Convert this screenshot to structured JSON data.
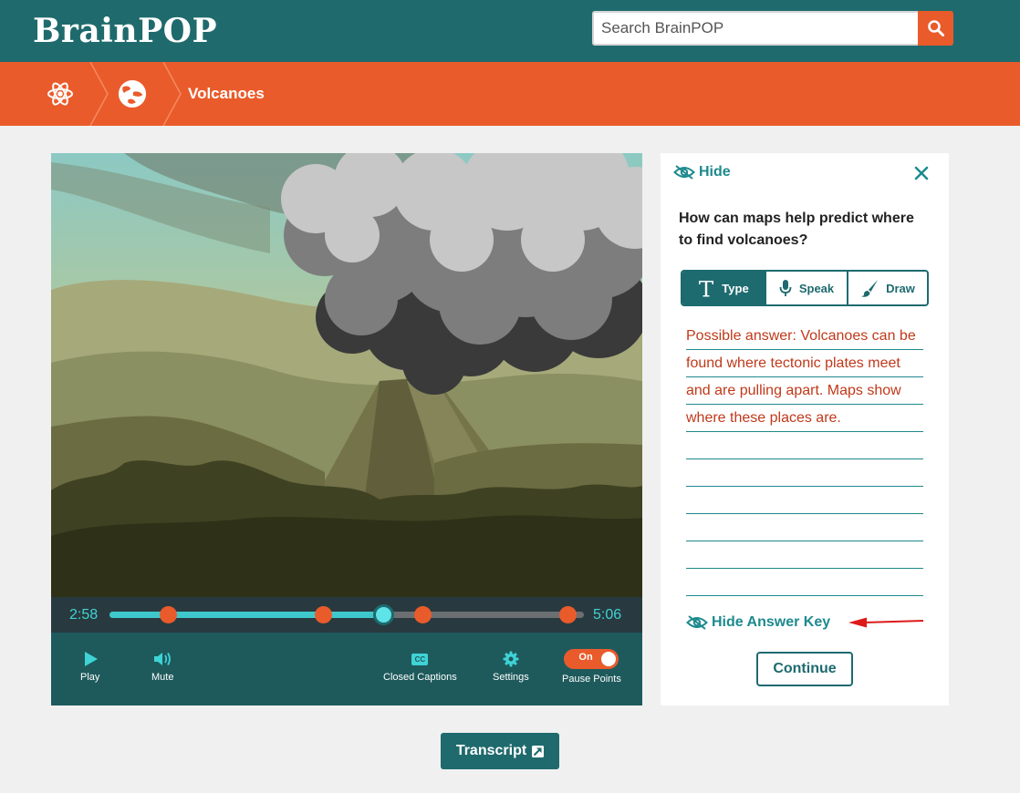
{
  "header": {
    "logo": "BrainPOP",
    "search_placeholder": "Search BrainPOP",
    "search_icon": "search-icon"
  },
  "breadcrumb": {
    "items": [
      {
        "icon": "atom-icon"
      },
      {
        "icon": "globe-icon"
      }
    ],
    "title": "Volcanoes"
  },
  "video": {
    "current_time": "2:58",
    "duration": "5:06",
    "progress": 0.577,
    "pause_points": [
      0.123,
      0.45,
      0.66,
      0.965
    ],
    "controls": {
      "play_label": "Play",
      "mute_label": "Mute",
      "captions_label": "Closed Captions",
      "captions_badge": "CC",
      "settings_label": "Settings",
      "pause_points_label": "Pause Points",
      "toggle_state": "On"
    }
  },
  "panel": {
    "hide_label": "Hide",
    "question": "How can maps help predict where to find volcanoes?",
    "modes": [
      "Type",
      "Speak",
      "Draw"
    ],
    "active_mode": "Type",
    "answer": "Possible answer: Volcanoes can be found where tectonic plates meet and are pulling apart. Maps show where these places are.",
    "hide_answer_key_label": "Hide Answer Key",
    "continue_label": "Continue"
  },
  "transcript_label": "Transcript",
  "colors": {
    "header_teal": "#1f6a6d",
    "brand_orange": "#ea5b2b",
    "accent_teal": "#1d8a8e",
    "answer_red": "#c0391a"
  }
}
